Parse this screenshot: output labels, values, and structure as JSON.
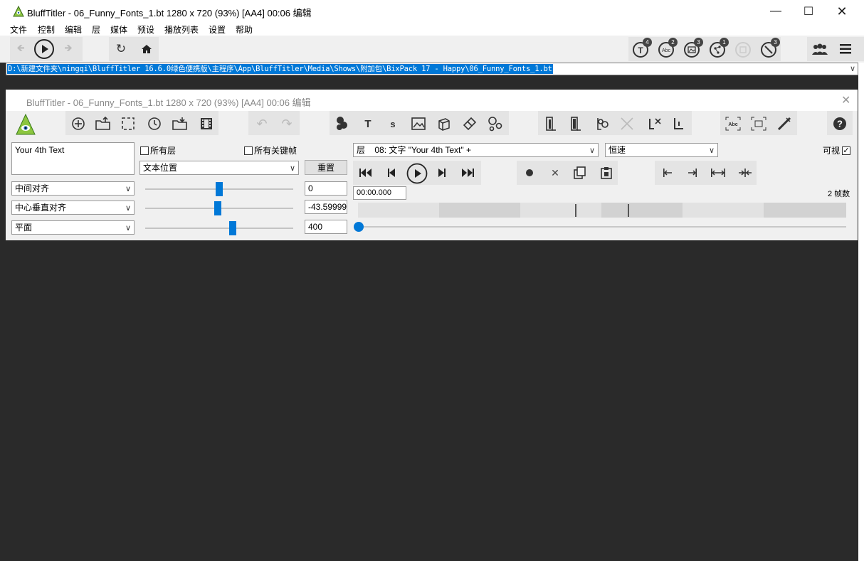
{
  "outer_window": {
    "title": "BluffTitler - 06_Funny_Fonts_1.bt 1280 x 720 (93%) [AA4] 00:06 编辑",
    "menu": [
      "文件",
      "控制",
      "编辑",
      "层",
      "媒体",
      "预设",
      "播放列表",
      "设置",
      "帮助"
    ],
    "badges": [
      "4",
      "2",
      "3",
      "1",
      "3"
    ],
    "path": "D:\\新建文件夹\\ningqi\\BluffTitler 16.6.0绿色便携版\\主程序\\App\\BluffTitler\\Media\\Shows\\附加包\\BixPack 17 - Happy\\06_Funny_Fonts_1.bt"
  },
  "inner_window": {
    "title": "BluffTitler - 06_Funny_Fonts_1.bt 1280 x 720 (93%) [AA4] 00:06 编辑",
    "text_value": "Your 4th Text",
    "all_layers_label": "所有层",
    "all_keyframes_label": "所有关键帧",
    "property_select": "文本位置",
    "reset_label": "重置",
    "align_h": "中间对齐",
    "align_v": "中心垂直对齐",
    "plane": "平面",
    "value_x": "0",
    "value_y": "-43.5999985",
    "value_z": "400",
    "layer_label": "层",
    "layer_select": "08: 文字 \"Your 4th Text\" +",
    "speed_select": "恒速",
    "visible_label": "可视",
    "time_value": "00:00.000",
    "frames_label": "2 帧数",
    "slider_x_level": 0.5,
    "slider_y_level": 0.49,
    "slider_z_level": 0.59
  }
}
